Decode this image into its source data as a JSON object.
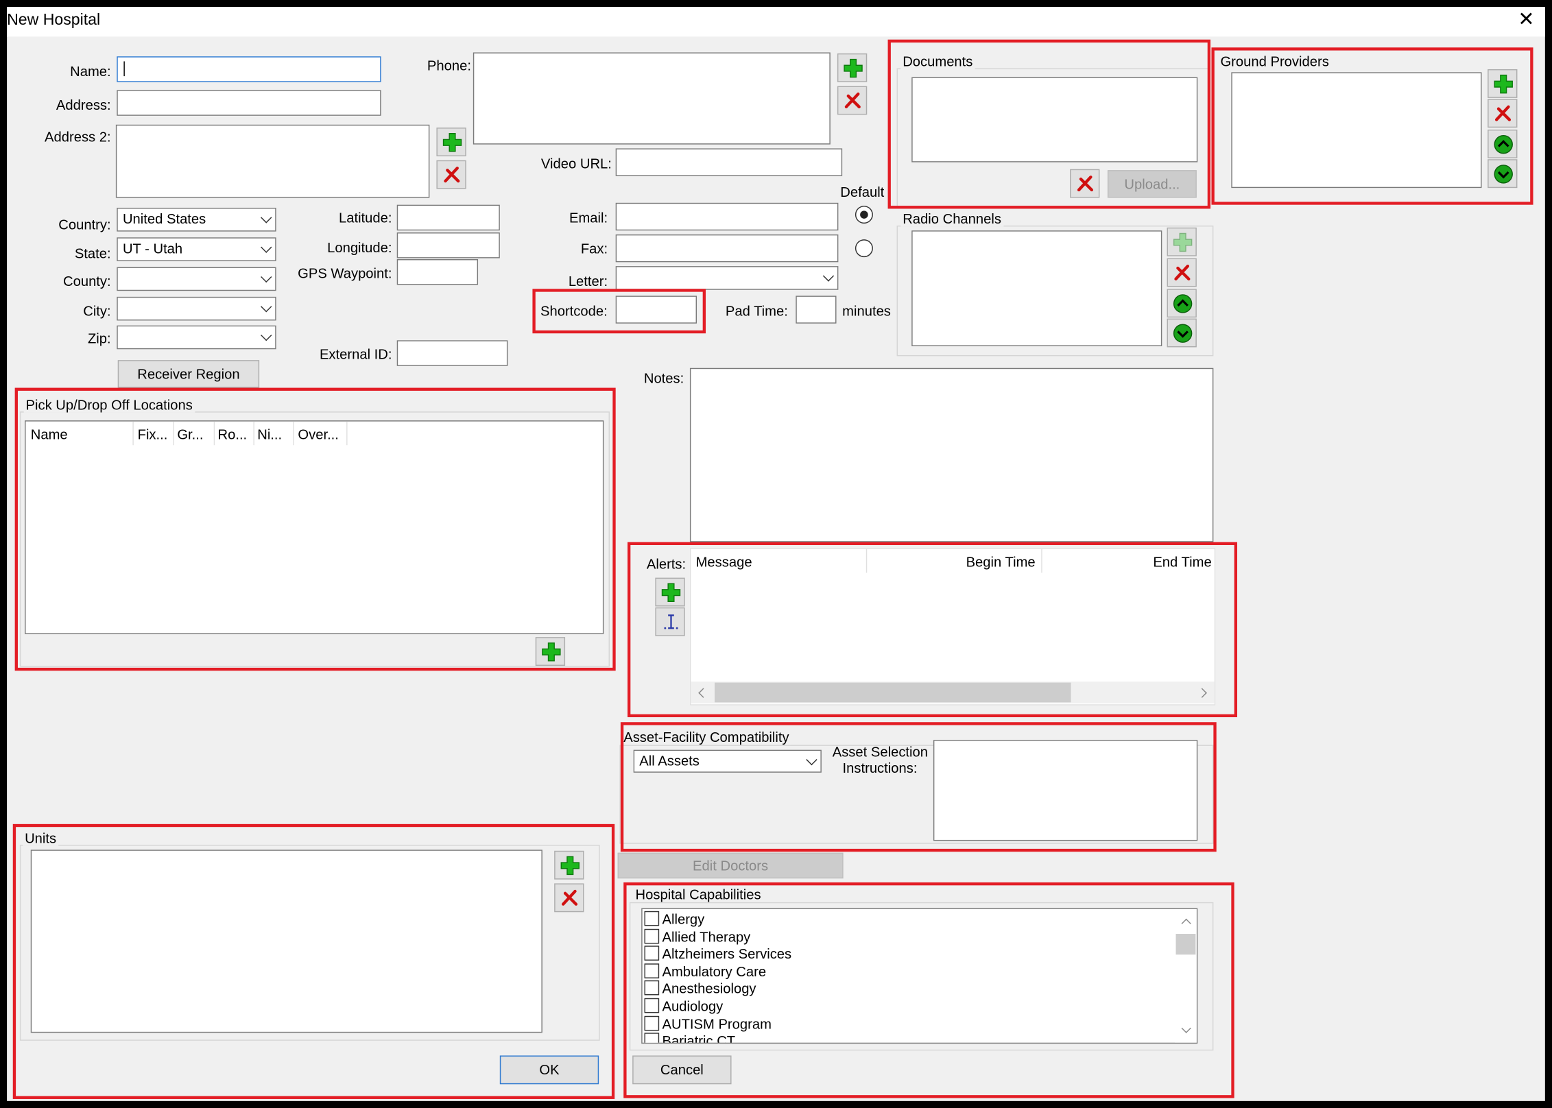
{
  "window": {
    "title": "New Hospital"
  },
  "form": {
    "name_label": "Name:",
    "name_value": "",
    "address_label": "Address:",
    "address_value": "",
    "address2_label": "Address 2:",
    "address2_value": "",
    "country_label": "Country:",
    "country_value": "United States",
    "state_label": "State:",
    "state_value": "UT - Utah",
    "county_label": "County:",
    "county_value": "",
    "city_label": "City:",
    "city_value": "",
    "zip_label": "Zip:",
    "zip_value": "",
    "latitude_label": "Latitude:",
    "latitude_value": "",
    "longitude_label": "Longitude:",
    "longitude_value": "",
    "gps_label": "GPS Waypoint:",
    "gps_value": "",
    "external_id_label": "External ID:",
    "external_id_value": "",
    "phone_label": "Phone:",
    "video_url_label": "Video URL:",
    "video_url_value": "",
    "default_label": "Default",
    "email_label": "Email:",
    "email_value": "",
    "fax_label": "Fax:",
    "fax_value": "",
    "letter_label": "Letter:",
    "letter_value": "",
    "shortcode_label": "Shortcode:",
    "shortcode_value": "",
    "pad_time_label": "Pad Time:",
    "pad_time_value": "",
    "pad_time_unit": "minutes",
    "notes_label": "Notes:",
    "notes_value": "",
    "receiver_region_button": "Receiver Region"
  },
  "documents": {
    "title": "Documents",
    "upload_button": "Upload..."
  },
  "ground_providers": {
    "title": "Ground Providers"
  },
  "radio_channels": {
    "title": "Radio Channels"
  },
  "pickup": {
    "title": "Pick Up/Drop Off Locations",
    "columns": [
      "Name",
      "Fix...",
      "Gr...",
      "Ro...",
      "Ni...",
      "Over..."
    ]
  },
  "alerts": {
    "label": "Alerts:",
    "columns": [
      "Message",
      "Begin Time",
      "End Time"
    ]
  },
  "asset": {
    "title": "Asset-Facility Compatibility",
    "select_value": "All Assets",
    "instructions_label_1": "Asset Selection",
    "instructions_label_2": "Instructions:",
    "instructions_value": ""
  },
  "edit_doctors_button": "Edit Doctors",
  "units": {
    "title": "Units"
  },
  "capabilities": {
    "title": "Hospital Capabilities",
    "items": [
      "Allergy",
      "Allied Therapy",
      "Altzheimers Services",
      "Ambulatory Care",
      "Anesthesiology",
      "Audiology",
      "AUTISM Program",
      "Bariatric CT"
    ]
  },
  "footer": {
    "ok_button": "OK",
    "cancel_button": "Cancel"
  },
  "icons": {
    "add": "plus-icon",
    "remove": "red-x-icon",
    "up": "arrow-up-icon",
    "down": "arrow-down-icon",
    "close": "close-icon"
  },
  "colors": {
    "highlight": "#e31d25",
    "add_green": "#1db81d",
    "focus_blue": "#2f7ad1"
  }
}
